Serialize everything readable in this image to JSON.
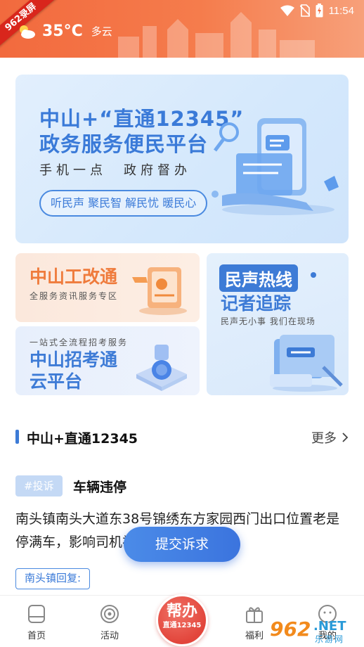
{
  "status_bar": {
    "time": "11:54"
  },
  "header": {
    "corner_badge": "962录屏",
    "temperature": "35°C",
    "condition": "多云"
  },
  "banner": {
    "title_line1": "中山+“直通12345”",
    "title_line2": "政务服务便民平台",
    "slogan": "手机一点　政府督办",
    "pill": "听民声 聚民智 解民忧 暖民心"
  },
  "cards": {
    "reform": {
      "title": "中山工改通",
      "subtitle": "全服务资讯服务专区"
    },
    "exam": {
      "subtitle": "一站式全流程招考服务",
      "title_line1": "中山招考通",
      "title_line2": "云平台"
    },
    "hotline": {
      "title_line1": "民声热线",
      "title_line2": "记者追踪",
      "subtitle": "民声无小事 我们在现场"
    }
  },
  "section": {
    "title": "中山+直通12345",
    "more": "更多"
  },
  "item": {
    "tag": "#投诉",
    "title": "车辆违停",
    "body": "南头镇南头大道东38号锦绣东方家园西门出口位置老是停满车，影响司机视线…",
    "reply_tag": "南头镇回复:"
  },
  "fab_label": "提交诉求",
  "bottom_nav": {
    "home": "首页",
    "activity": "活动",
    "center_line1": "帮办",
    "center_line2": "直通12345",
    "welfare": "福利",
    "mine": "我的"
  },
  "watermark": {
    "num": "962",
    "net": ".NET",
    "sub": "乐游网"
  },
  "colors": {
    "header_orange": "#f26a3e",
    "primary_blue": "#3d7bd6",
    "center_red": "#e2453b"
  }
}
